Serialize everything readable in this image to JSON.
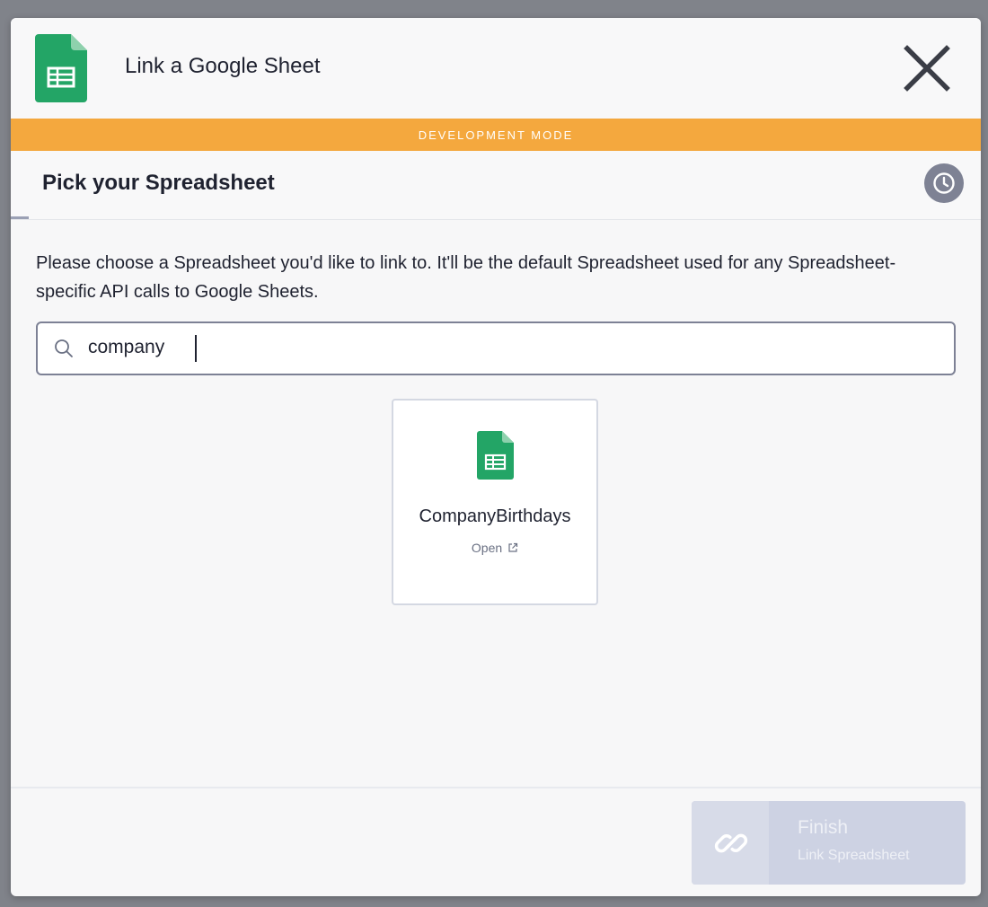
{
  "modal": {
    "title": "Link a Google Sheet",
    "brand_color": "#23a566"
  },
  "banner": {
    "text": "DEVELOPMENT MODE",
    "color": "#f4a83e"
  },
  "step": {
    "title": "Pick your Spreadsheet",
    "history_icon": "clock-icon"
  },
  "description": "Please choose a Spreadsheet you'd like to link to. It'll be the default Spreadsheet used for any Spreadsheet-specific API calls to Google Sheets.",
  "search": {
    "value": "company",
    "icon": "search-icon"
  },
  "results": [
    {
      "name": "CompanyBirthdays",
      "open_label": "Open",
      "icon": "google-sheets-icon"
    }
  ],
  "footer": {
    "finish_label": "Finish",
    "finish_sub": "Link Spreadsheet",
    "finish_icon": "link-icon"
  }
}
